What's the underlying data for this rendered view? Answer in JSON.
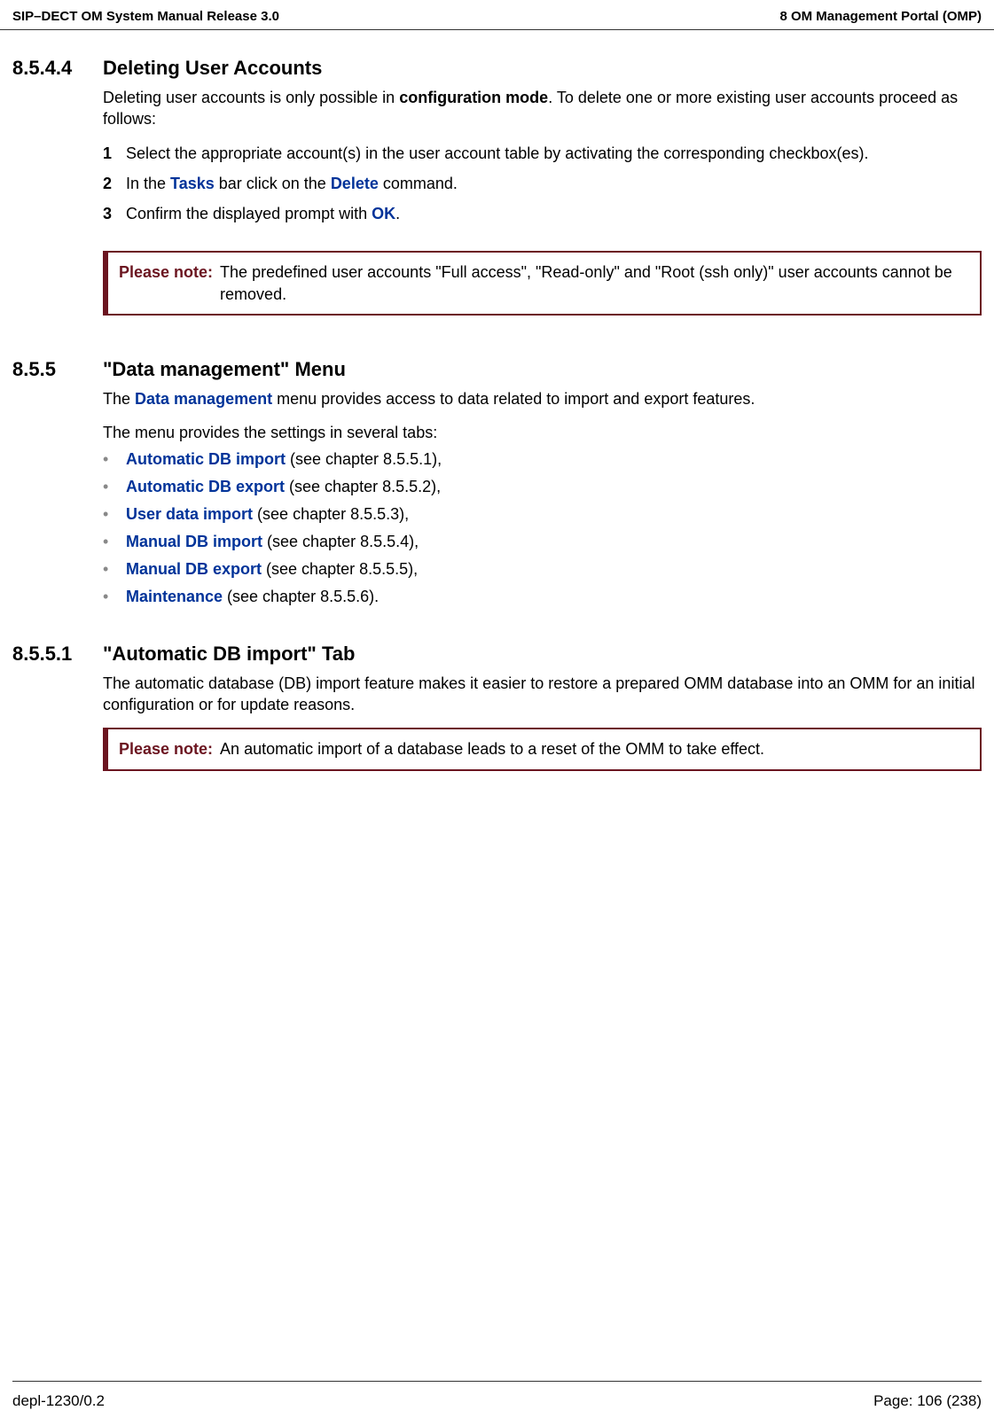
{
  "header": {
    "left": "SIP–DECT OM System Manual Release 3.0",
    "right": "8 OM Management Portal (OMP)"
  },
  "s1": {
    "num": "8.5.4.4",
    "title": "Deleting User Accounts",
    "intro_a": "Deleting user accounts is only possible in ",
    "intro_b": "configuration mode",
    "intro_c": ". To delete one or more existing user accounts proceed as follows:",
    "step1_num": "1",
    "step1": "Select the appropriate account(s) in the user account table by activating the corresponding checkbox(es).",
    "step2_num": "2",
    "step2_a": "In the ",
    "step2_b": "Tasks",
    "step2_c": " bar click on the ",
    "step2_d": "Delete",
    "step2_e": " command.",
    "step3_num": "3",
    "step3_a": "Confirm the displayed prompt with ",
    "step3_b": "OK",
    "step3_c": ".",
    "note_label": "Please note:",
    "note_text": "The predefined user accounts \"Full access\", \"Read-only\" and \"Root (ssh only)\" user accounts cannot be removed."
  },
  "s2": {
    "num": "8.5.5",
    "title": "\"Data management\" Menu",
    "intro_a": "The ",
    "intro_b": "Data management",
    "intro_c": " menu provides access to data related to import and export features.",
    "lead": "The menu provides the settings in several tabs:",
    "b1_a": "Automatic DB import",
    "b1_b": " (see chapter 8.5.5.1),",
    "b2_a": "Automatic DB export",
    "b2_b": " (see chapter 8.5.5.2),",
    "b3_a": "User data import",
    "b3_b": " (see chapter 8.5.5.3),",
    "b4_a": "Manual DB import",
    "b4_b": " (see chapter 8.5.5.4),",
    "b5_a": "Manual DB export",
    "b5_b": " (see chapter 8.5.5.5),",
    "b6_a": "Maintenance",
    "b6_b": " (see chapter 8.5.5.6)."
  },
  "s3": {
    "num": "8.5.5.1",
    "title": "\"Automatic DB import\" Tab",
    "intro": "The automatic database (DB) import feature makes it easier to restore a prepared OMM database into an OMM for an initial configuration or for update reasons.",
    "note_label": "Please note:",
    "note_text": "An automatic import of a database leads to a reset of the OMM to take effect."
  },
  "footer": {
    "left": "depl-1230/0.2",
    "right": "Page: 106 (238)"
  },
  "bullet_char": "•"
}
